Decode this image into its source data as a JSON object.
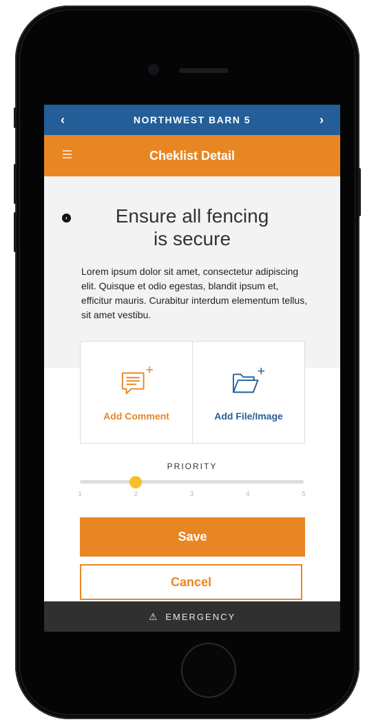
{
  "header": {
    "location": "NORTHWEST BARN 5",
    "prev_icon": "chevron-left-icon",
    "next_icon": "chevron-right-icon"
  },
  "toolbar": {
    "title": "Cheklist Detail",
    "menu_icon": "hamburger-menu-icon"
  },
  "item": {
    "title_line1": "Ensure all fencing",
    "title_line2": "is secure",
    "description": "Lorem ipsum dolor sit amet, consectetur adipiscing elit. Quisque et odio egestas, blandit ipsum et, efficitur mauris. Curabitur interdum elementum tellus, sit amet vestibu."
  },
  "actions": {
    "add_comment": "Add Comment",
    "add_file": "Add File/Image"
  },
  "priority": {
    "label": "PRIORITY",
    "ticks": [
      "1",
      "2",
      "3",
      "4",
      "5"
    ],
    "value": 2,
    "min": 1,
    "max": 5
  },
  "buttons": {
    "save": "Save",
    "cancel": "Cancel"
  },
  "footer": {
    "emergency": "EMERGENCY",
    "icon": "warning-triangle-icon"
  },
  "colors": {
    "blue": "#245e98",
    "orange": "#e88624",
    "slider_thumb": "#f5c128",
    "footer": "#303030"
  }
}
